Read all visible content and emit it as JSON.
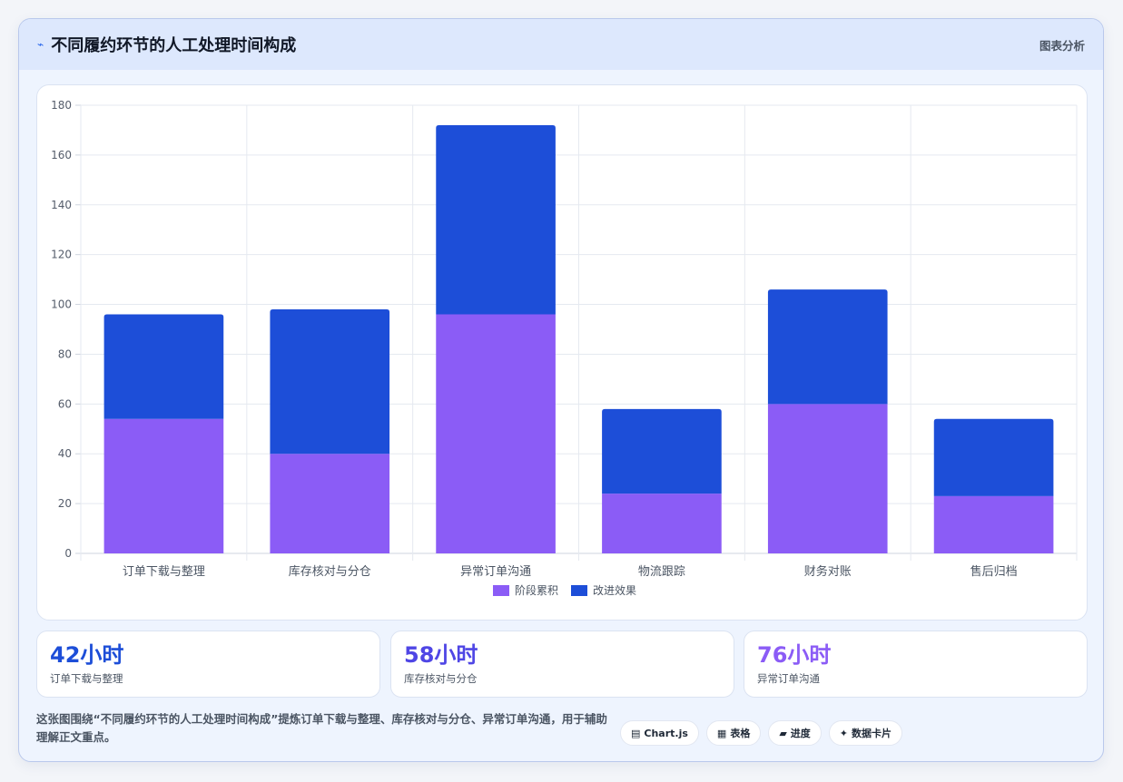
{
  "header": {
    "icon": "chart-line-icon",
    "icon_glyph": "⌁",
    "title": "不同履约环节的人工处理时间构成",
    "tag": "图表分析"
  },
  "chart_data": {
    "type": "bar",
    "stacked": true,
    "categories": [
      "订单下载与整理",
      "库存核对与分仓",
      "异常订单沟通",
      "物流跟踪",
      "财务对账",
      "售后归档"
    ],
    "series": [
      {
        "name": "阶段累积",
        "color": "#8b5cf6",
        "values": [
          54,
          40,
          96,
          24,
          60,
          23
        ]
      },
      {
        "name": "改进效果",
        "color": "#1d4ed8",
        "values": [
          42,
          58,
          76,
          34,
          46,
          31
        ]
      }
    ],
    "ylim": [
      0,
      180
    ],
    "yticks": [
      0,
      20,
      40,
      60,
      80,
      100,
      120,
      140,
      160,
      180
    ],
    "grid": true,
    "legend": "bottom"
  },
  "stats": [
    {
      "value": "42小时",
      "label": "订单下载与整理",
      "color": "#1d4ed8"
    },
    {
      "value": "58小时",
      "label": "库存核对与分仓",
      "color": "#4f46e5"
    },
    {
      "value": "76小时",
      "label": "异常订单沟通",
      "color": "#8b5cf6"
    }
  ],
  "footer": {
    "text": "这张图围绕“不同履约环节的人工处理时间构成”提炼订单下载与整理、库存核对与分仓、异常订单沟通，用于辅助理解正文重点。",
    "chips": [
      {
        "icon": "chart-icon",
        "glyph": "▤",
        "label": "Chart.js"
      },
      {
        "icon": "table-icon",
        "glyph": "▦",
        "label": "表格"
      },
      {
        "icon": "progress-icon",
        "glyph": "▰",
        "label": "进度"
      },
      {
        "icon": "card-icon",
        "glyph": "✦",
        "label": "数据卡片"
      }
    ]
  }
}
